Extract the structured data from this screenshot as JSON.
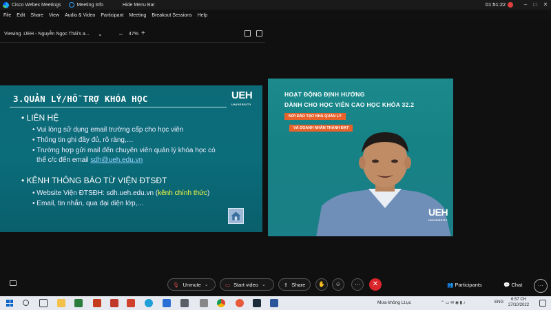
{
  "titlebar": {
    "app_title": "Cisco Webex Meetings",
    "meeting_info": "Meeting Info",
    "hide_menu": "Hide Menu Bar",
    "clock": "01:51:22",
    "minimize": "–",
    "maximize": "□",
    "close": "✕"
  },
  "menu": [
    "File",
    "Edit",
    "Share",
    "View",
    "Audio & Video",
    "Participant",
    "Meeting",
    "Breakout Sessions",
    "Help"
  ],
  "viewbar": {
    "viewing": "Viewing .UEH - Nguyễn Ngọc Thái's a...",
    "chevron": "⌄",
    "zoom_minus": "–",
    "zoom_level": "47%",
    "zoom_plus": "+"
  },
  "slide": {
    "title": "3.QUẢN LÝ/HỖ TRỢ KHÓA HỌC",
    "logo": "UEH",
    "logo_sub": "UNIVERSITY",
    "section1": "LIÊN HỆ",
    "bullets1": [
      "Vui lòng sử dụng email trường cấp cho học viên",
      "Thông tin ghi đầy đủ, rõ ràng,…",
      "Trường hợp gửi mail đến chuyên viên quản lý khóa học có",
      "thể c/c đến email "
    ],
    "email": "sdh@ueh.edu.vn",
    "section2": "KÊNH THÔNG BÁO TỪ VIỆN ĐTSĐT",
    "bullet2a": "Website Viện ĐTSĐH: sdh.ueh.edu.vn (",
    "bullet2a_highlight": "kênh chính thức",
    "bullet2a_end": ")",
    "bullet2b": "Email, tin nhắn, qua đại diện lớp,…"
  },
  "video": {
    "title1": "HOẠT ĐỘNG ĐỊNH HƯỚNG",
    "title2": "DÀNH CHO HỌC VIÊN CAO HỌC KHÓA 32.2",
    "tag1": "NƠI ĐÀO TẠO NHÀ QUẢN LÝ",
    "tag2": "VÀ DOANH NHÂN THÀNH ĐẠT",
    "logo": "UEH",
    "logo_sub": "UNIVERSITY"
  },
  "controls": {
    "unmute": "Unmute",
    "start_video": "Start video",
    "share": "Share",
    "participants": "Participants",
    "chat": "Chat",
    "more": "···",
    "end": "✕"
  },
  "taskbar": {
    "weather": "Mưa không Lt.ục",
    "lang": "ENG",
    "time": "6:57 CH",
    "date": "27/10/2022"
  }
}
